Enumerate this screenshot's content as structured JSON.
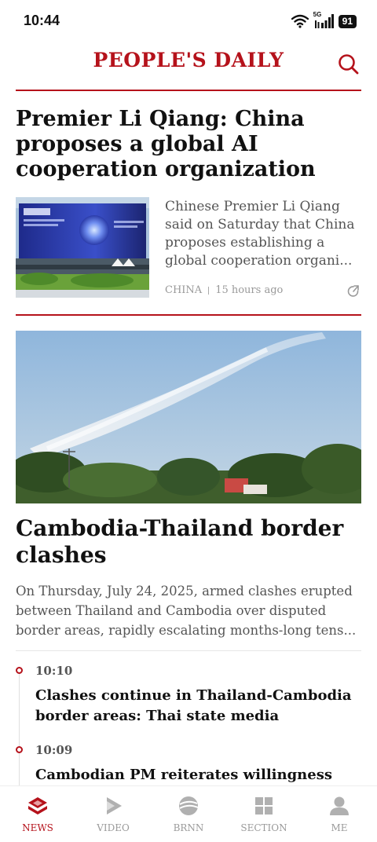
{
  "status_bar": {
    "time": "10:44",
    "network": "5G",
    "battery": "91"
  },
  "header": {
    "logo": "PEOPLE'S DAILY"
  },
  "article_1": {
    "title": "Premier Li Qiang: China proposes a global AI cooperation organization",
    "summary": "Chinese Premier Li Qiang said on Saturday that China proposes establishing a global cooperation organi...",
    "category": "CHINA",
    "time": "15 hours ago"
  },
  "article_2": {
    "title": "Cambodia-Thailand border clashes",
    "summary": "On Thursday, July 24, 2025, armed clashes erupted between Thailand and Cambodia over disputed border areas, rapidly escalating months-long tens..."
  },
  "timeline": [
    {
      "time": "10:10",
      "title": "Clashes continue in Thailand-Cambodia border areas: Thai state media"
    },
    {
      "time": "10:09",
      "title": "Cambodian PM reiterates willingness for"
    }
  ],
  "tabs": [
    {
      "label": "NEWS",
      "icon": "news-icon",
      "active": true
    },
    {
      "label": "VIDEO",
      "icon": "video-icon"
    },
    {
      "label": "BRNN",
      "icon": "brnn-icon"
    },
    {
      "label": "SECTION",
      "icon": "section-icon"
    },
    {
      "label": "ME",
      "icon": "me-icon"
    }
  ],
  "colors": {
    "brand": "#b5121b",
    "text": "#111111",
    "muted": "#555555",
    "tab_inactive": "#9a9a9a"
  }
}
